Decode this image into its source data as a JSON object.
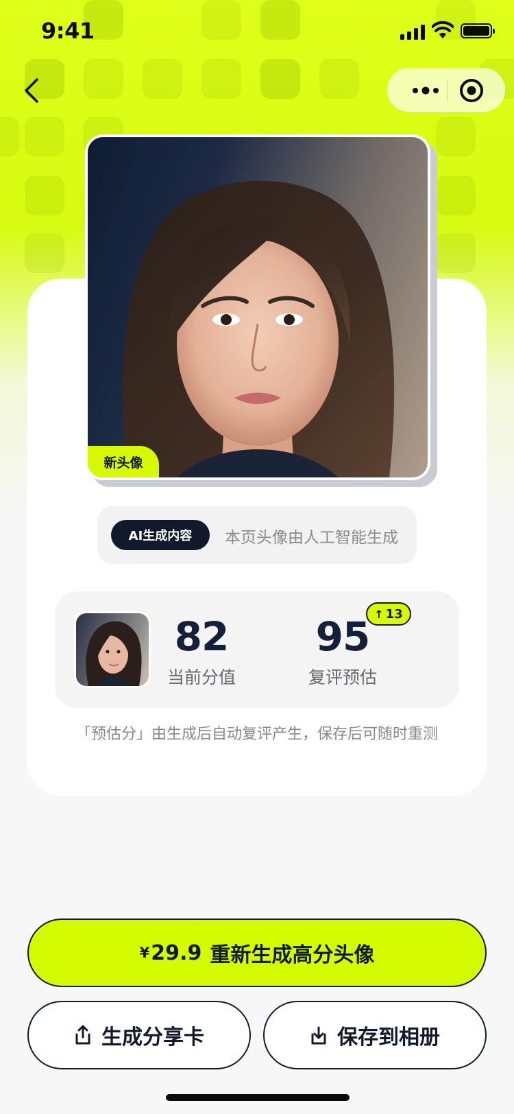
{
  "status_bar": {
    "time": "9:41"
  },
  "avatar_card": {
    "new_tag": "新头像",
    "ai_badge": "AI生成内容",
    "ai_notice": "本页头像由人工智能生成"
  },
  "scores": {
    "current": {
      "value": "82",
      "label": "当前分值"
    },
    "estimated": {
      "value": "95",
      "label": "复评预估",
      "delta": "13"
    }
  },
  "note": "「预估分」由生成后自动复评产生，保存后可随时重测",
  "actions": {
    "regenerate_price": "¥",
    "regenerate_amount": "29.9",
    "regenerate_label": "重新生成高分头像",
    "share_label": "生成分享卡",
    "save_label": "保存到相册"
  },
  "icons": [
    "back-icon",
    "more-icon",
    "target-icon",
    "share-icon",
    "download-icon"
  ],
  "colors": {
    "accent": "#d5fb00",
    "dark": "#111a2b"
  }
}
